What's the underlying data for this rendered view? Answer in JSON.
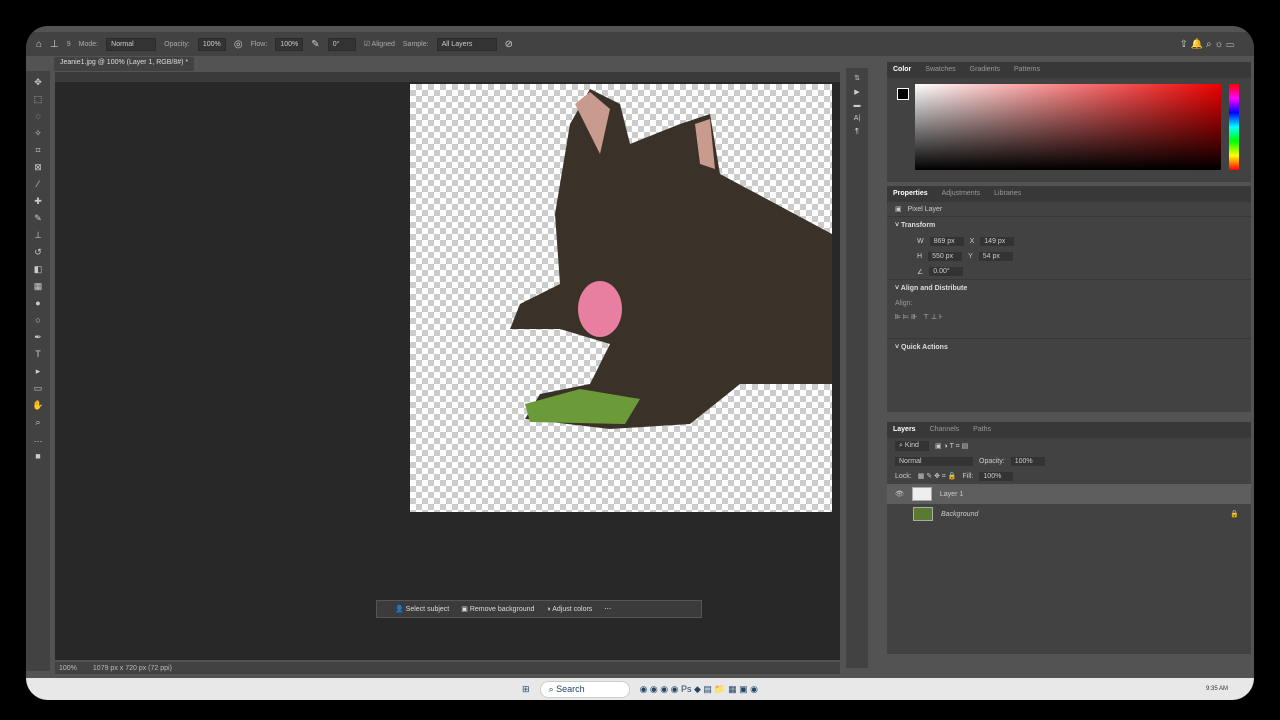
{
  "options": {
    "mode_label": "Mode:",
    "mode": "Normal",
    "opacity_label": "Opacity:",
    "opacity": "100%",
    "flow_label": "Flow:",
    "flow": "100%",
    "angle": "0°",
    "aligned": "Aligned",
    "sample_label": "Sample:",
    "sample": "All Layers",
    "brush_size": "9"
  },
  "doc_tab": "Jeanie1.jpg @ 100% (Layer 1, RGB/8#) *",
  "context_bar": {
    "select_subject": "Select subject",
    "remove_background": "Remove background",
    "adjust_colors": "Adjust colors"
  },
  "status": {
    "zoom": "100%",
    "dims": "1079 px x 720 px (72 ppi)"
  },
  "color_panel": {
    "tabs": [
      "Color",
      "Swatches",
      "Gradients",
      "Patterns"
    ]
  },
  "properties": {
    "tabs": [
      "Properties",
      "Adjustments",
      "Libraries"
    ],
    "type": "Pixel Layer",
    "transform": "Transform",
    "w": "869 px",
    "h": "550 px",
    "x": "149 px",
    "y": "54 px",
    "angle": "0.00°",
    "align_title": "Align and Distribute",
    "align_label": "Align:",
    "quick_actions": "Quick Actions"
  },
  "layers": {
    "tabs": [
      "Layers",
      "Channels",
      "Paths"
    ],
    "kind": "Kind",
    "blend": "Normal",
    "opacity_label": "Opacity:",
    "opacity": "100%",
    "lock_label": "Lock:",
    "fill_label": "Fill:",
    "fill": "100%",
    "items": [
      "Layer 1",
      "Background"
    ]
  },
  "taskbar": {
    "search": "Search",
    "time": "9:35 AM"
  }
}
